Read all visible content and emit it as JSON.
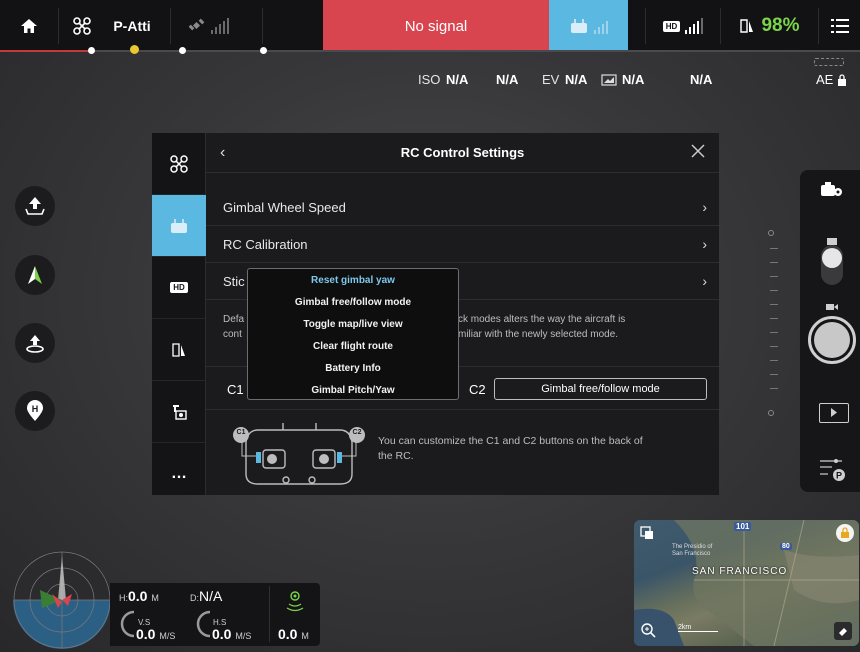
{
  "topbar": {
    "flight_mode": "P-Atti",
    "signal_text": "No signal",
    "hd_label": "HD",
    "battery_percent": "98%"
  },
  "camera_params": {
    "iso_label": "ISO",
    "iso_value": "N/A",
    "shutter_value": "N/A",
    "ev_label": "EV",
    "ev_value": "N/A",
    "wb_value": "N/A",
    "storage_value": "N/A",
    "ae_label": "AE"
  },
  "modal": {
    "title": "RC Control Settings",
    "rows": [
      {
        "label": "Gimbal Wheel Speed"
      },
      {
        "label": "RC Calibration"
      },
      {
        "label": "Stic"
      }
    ],
    "sidebar_tabs": [
      "aircraft-icon",
      "remote-controller-icon",
      "hd-icon",
      "battery-icon",
      "gimbal-icon",
      "more-icon"
    ],
    "hd_tab_label": "HD",
    "more_tab_label": "…",
    "desc_left_1": "Defa",
    "desc_left_2": "cont",
    "desc_right_1": "ck modes alters the way the aircraft is",
    "desc_right_2": "miliar with the newly selected mode.",
    "c1_label": "C1",
    "c2_label": "C2",
    "c2_value": "Gimbal free/follow mode",
    "diagram_c1": "C1",
    "diagram_c2": "C2",
    "customize_text_1": "You can customize the C1 and C2 buttons on the back of",
    "customize_text_2": "the RC.",
    "popup_options": [
      "Reset gimbal yaw",
      "Gimbal free/follow mode",
      "Toggle map/live view",
      "Clear flight route",
      "Battery Info",
      "Gimbal Pitch/Yaw"
    ],
    "popup_selected_index": 0
  },
  "telemetry": {
    "h_label": "H:",
    "h_value": "0.0",
    "h_unit": "M",
    "d_label": "D:",
    "d_value": "N/A",
    "vs_label": "V.S",
    "vs_value": "0.0",
    "vs_unit": "M/S",
    "hs_label": "H.S",
    "hs_value": "0.0",
    "hs_unit": "M/S",
    "dist_value": "0.0",
    "dist_unit": "M"
  },
  "map": {
    "city_label": "SAN FRANCISCO",
    "road_1": "101",
    "road_2": "80",
    "district": "The Presidio of San Francisco",
    "scale_label": "2km"
  },
  "colors": {
    "accent_blue": "#5ab8e1",
    "signal_red": "#d8454e",
    "battery_green": "#7bd34a",
    "selected_option": "#7ec8ec"
  }
}
